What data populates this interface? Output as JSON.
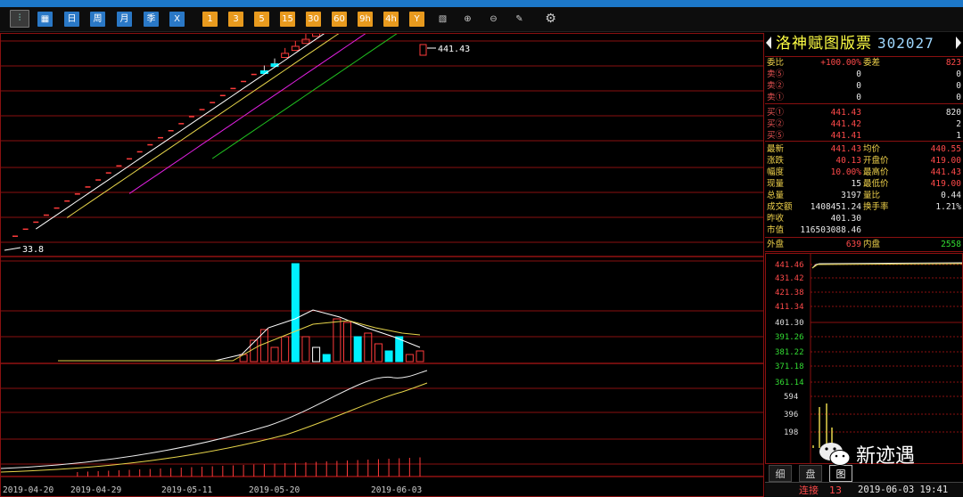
{
  "toolbar": {
    "buttons": [
      {
        "label": "",
        "icon": "kline-chart-icon",
        "style": "first"
      },
      {
        "label": "",
        "icon": "calendar-icon",
        "style": "blue"
      },
      {
        "label": "日",
        "style": "blue"
      },
      {
        "label": "周",
        "style": "blue"
      },
      {
        "label": "月",
        "style": "blue"
      },
      {
        "label": "季",
        "style": "blue"
      },
      {
        "label": "X",
        "style": "blue"
      },
      {
        "label": "1",
        "style": "orange"
      },
      {
        "label": "3",
        "style": "orange"
      },
      {
        "label": "5",
        "style": "orange"
      },
      {
        "label": "15",
        "style": "orange"
      },
      {
        "label": "30",
        "style": "orange"
      },
      {
        "label": "60",
        "style": "orange"
      },
      {
        "label": "9h",
        "style": "orange"
      },
      {
        "label": "4h",
        "style": "orange"
      },
      {
        "label": "Y",
        "style": "orange"
      },
      {
        "label": "",
        "icon": "draw-tool-icon",
        "style": "gray"
      },
      {
        "label": "",
        "icon": "zoom-in-icon",
        "style": "gray"
      },
      {
        "label": "",
        "icon": "zoom-out-icon",
        "style": "gray"
      },
      {
        "label": "",
        "icon": "pencil-icon",
        "style": "gray"
      },
      {
        "label": "",
        "icon": "gear-icon",
        "style": "gray"
      }
    ]
  },
  "chart": {
    "last_price_label": "441.43",
    "low_price_label": "33.8",
    "x_dates": [
      "2019-04-20",
      "2019-04-29",
      "2019-05-11",
      "2019-05-20",
      "2019-06-03"
    ],
    "colors": {
      "up": "#ff3b3b",
      "down": "#00f0ff",
      "ma5": "#ffffff",
      "ma10": "#e6d44a",
      "ma20": "#e020e0",
      "ma30": "#20c020",
      "grid": "#8a1010"
    }
  },
  "chart_data": {
    "type": "candlestick",
    "panels": [
      "price",
      "volume",
      "indicator"
    ],
    "candles_highlight": {
      "last_close": 441.43,
      "first_low": 33.8
    },
    "volume": "relative",
    "x_tick_labels": [
      "2019-04-20",
      "2019-04-29",
      "2019-05-11",
      "2019-05-20",
      "2019-06-03"
    ]
  },
  "quote": {
    "name": "洛神赋图版票",
    "code": "302027",
    "rows": [
      {
        "l1": "委比",
        "v1": "+100.00%",
        "c1": "red",
        "l2": "委差",
        "v2": "823",
        "c2": "red"
      },
      {
        "l1": "卖⑤",
        "v1": "0",
        "c1": "wht",
        "l2": "",
        "v2": "0",
        "c2": "wht"
      },
      {
        "l1": "卖②",
        "v1": "0",
        "c1": "wht",
        "l2": "",
        "v2": "0",
        "c2": "wht"
      },
      {
        "l1": "卖①",
        "v1": "0",
        "c1": "wht",
        "l2": "",
        "v2": "0",
        "c2": "wht"
      },
      {
        "l1": "买①",
        "v1": "441.43",
        "c1": "red",
        "l2": "",
        "v2": "820",
        "c2": "wht"
      },
      {
        "l1": "买②",
        "v1": "441.42",
        "c1": "red",
        "l2": "",
        "v2": "2",
        "c2": "wht"
      },
      {
        "l1": "买⑤",
        "v1": "441.41",
        "c1": "red",
        "l2": "",
        "v2": "1",
        "c2": "wht"
      },
      {
        "l1": "最新",
        "v1": "441.43",
        "c1": "red",
        "l2": "均价",
        "v2": "440.55",
        "c2": "red"
      },
      {
        "l1": "涨跌",
        "v1": "40.13",
        "c1": "red",
        "l2": "开盘价",
        "v2": "419.00",
        "c2": "red"
      },
      {
        "l1": "幅度",
        "v1": "10.00%",
        "c1": "red",
        "l2": "最高价",
        "v2": "441.43",
        "c2": "red"
      },
      {
        "l1": "现量",
        "v1": "15",
        "c1": "wht",
        "l2": "最低价",
        "v2": "419.00",
        "c2": "red"
      },
      {
        "l1": "总量",
        "v1": "3197",
        "c1": "wht",
        "l2": "量比",
        "v2": "0.44",
        "c2": "wht"
      },
      {
        "l1": "成交额",
        "v1": "1408451.24",
        "c1": "wht",
        "l2": "换手率",
        "v2": "1.21%",
        "c2": "wht"
      },
      {
        "l1": "昨收",
        "v1": "401.30",
        "c1": "wht",
        "l2": "",
        "v2": "",
        "c2": "wht"
      },
      {
        "l1": "市值",
        "v1": "116503088.46",
        "c1": "wht",
        "l2": "",
        "v2": "",
        "c2": "wht"
      }
    ],
    "outer_label": "外盘",
    "outer_value": "639",
    "inner_label": "内盘",
    "inner_value": "2558"
  },
  "mini_chart": {
    "price_ticks": [
      "441.46",
      "431.42",
      "421.38",
      "411.34",
      "401.30",
      "391.26",
      "381.22",
      "371.18",
      "361.14"
    ],
    "vol_ticks": [
      "594",
      "396",
      "198"
    ]
  },
  "tabs": [
    {
      "label": "细"
    },
    {
      "label": "盘"
    },
    {
      "label": "图"
    }
  ],
  "status": {
    "label": "连接",
    "count": "13",
    "datetime": "2019-06-03 19:41"
  },
  "watermark": {
    "text": "新迹遇"
  }
}
